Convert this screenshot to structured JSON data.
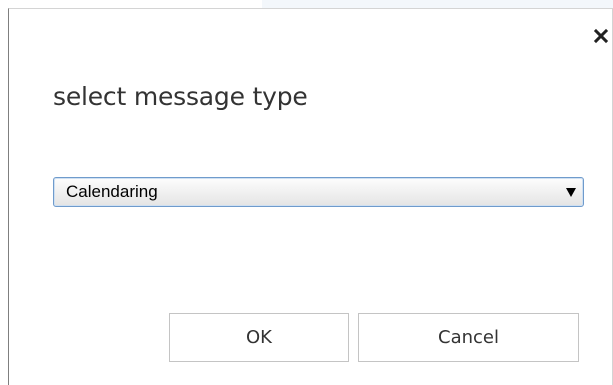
{
  "dialog": {
    "title": "select message type",
    "close_icon": "close-icon",
    "message_type_select": {
      "selected_value": "Calendaring",
      "arrow_icon": "dropdown-arrow-icon"
    },
    "buttons": {
      "ok_label": "OK",
      "cancel_label": "Cancel"
    }
  }
}
